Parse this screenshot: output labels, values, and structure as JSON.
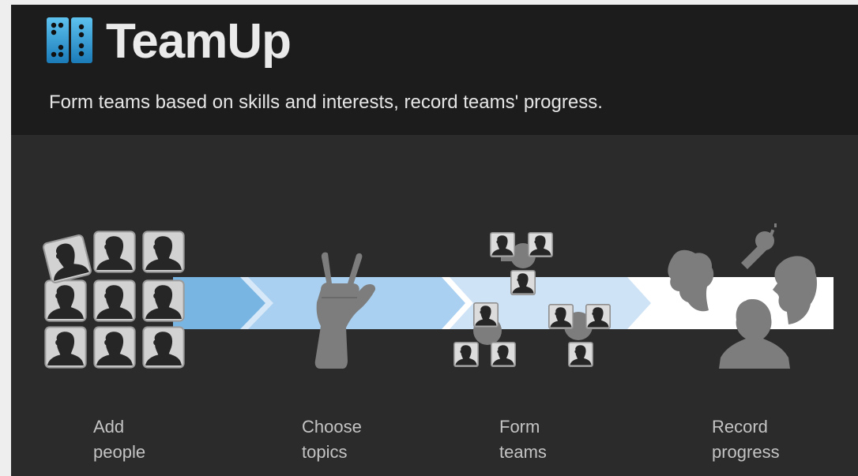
{
  "app": {
    "title": "TeamUp",
    "tagline": "Form teams based on skills and interests, record teams' progress."
  },
  "colors": {
    "header_bg": "#1c1c1c",
    "panel_bg": "#2b2b2b",
    "arrow_dark": "#7ab6e4",
    "arrow_light": "#cfe4f6",
    "arrow_end": "#ffffff",
    "logo_blue": "#2a8ec9",
    "figure_gray": "#7d7d7d"
  },
  "steps": [
    {
      "line1": "Add",
      "line2": "people",
      "icon": "people-grid-icon"
    },
    {
      "line1": "Choose",
      "line2": "topics",
      "icon": "peace-hand-icon"
    },
    {
      "line1": "Form",
      "line2": "teams",
      "icon": "teams-icon"
    },
    {
      "line1": "Record",
      "line2": "progress",
      "icon": "speaking-heads-icon"
    }
  ]
}
